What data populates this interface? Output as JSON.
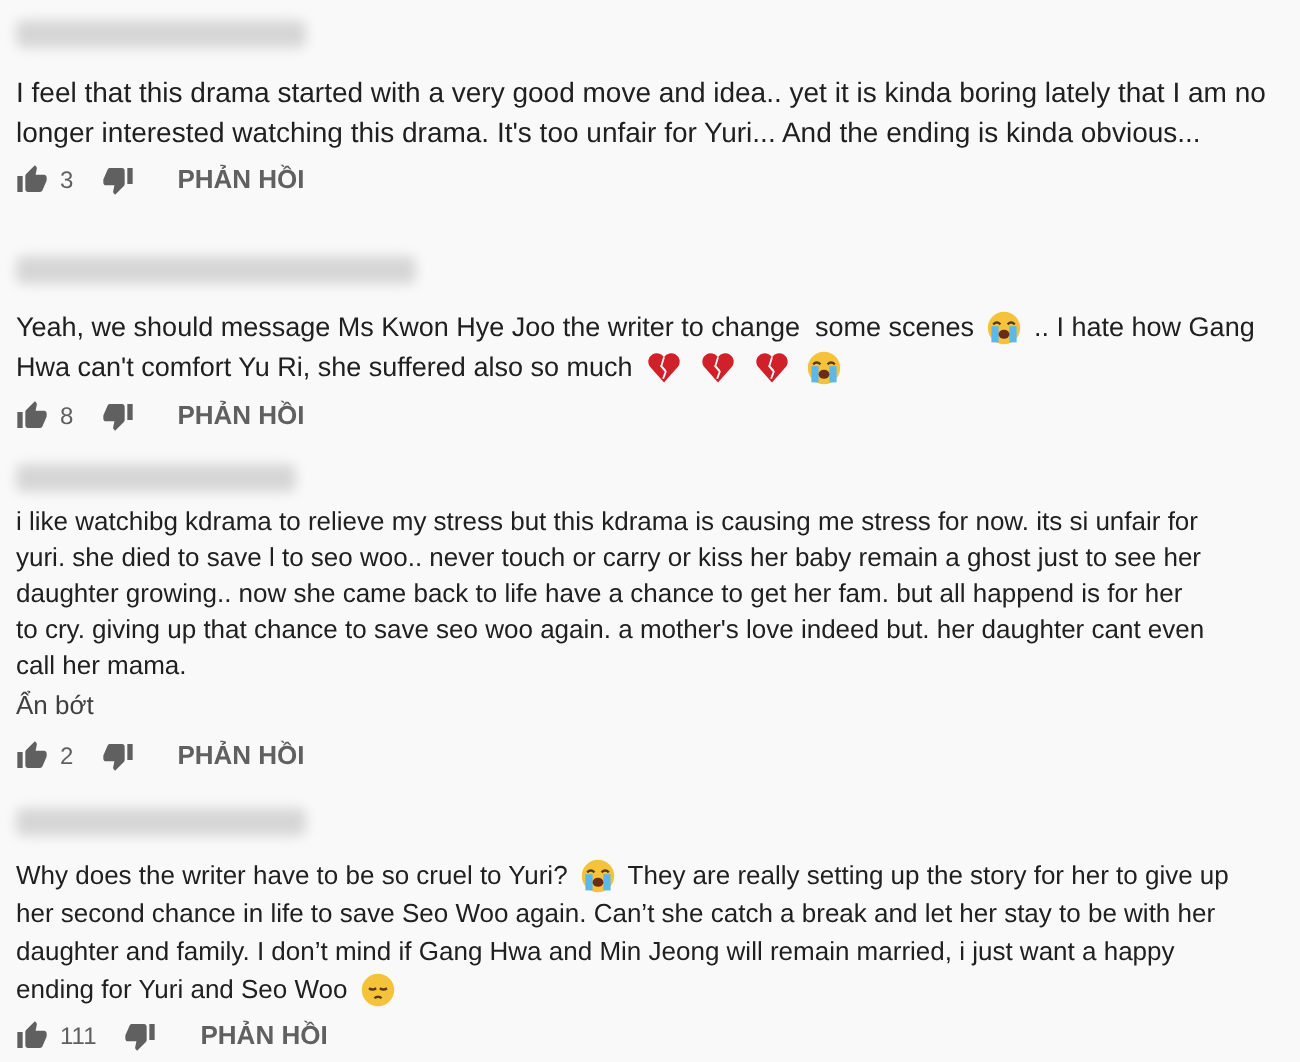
{
  "comments": [
    {
      "lines": [
        [
          {
            "kind": "text",
            "text": "I feel that this drama started with a very good move and idea.. yet it is kinda boring lately that I am no"
          }
        ],
        [
          {
            "kind": "text",
            "text": "longer interested watching this drama. It's too unfair for Yuri... And the ending is kinda obvious..."
          }
        ]
      ],
      "likes": "3",
      "reply": "PHẢN HỒI"
    },
    {
      "lines": [
        [
          {
            "kind": "text",
            "text": "Yeah, we should message Ms Kwon Hye Joo the writer to change  some scenes"
          },
          {
            "kind": "crying"
          },
          {
            "kind": "text",
            "text": ".. I hate how Gang"
          }
        ],
        [
          {
            "kind": "text",
            "text": "Hwa can't comfort Yu Ri, she suffered also so much"
          },
          {
            "kind": "broken_heart"
          },
          {
            "kind": "broken_heart"
          },
          {
            "kind": "broken_heart"
          },
          {
            "kind": "crying"
          }
        ]
      ],
      "likes": "8",
      "reply": "PHẢN HỒI"
    },
    {
      "lines": [
        [
          {
            "kind": "text",
            "text": "i like watchibg kdrama to relieve my stress but this kdrama is causing me stress for now. its si unfair for"
          }
        ],
        [
          {
            "kind": "text",
            "text": "yuri. she died to save l to seo woo.. never touch or carry or kiss her baby remain a ghost just to see her"
          }
        ],
        [
          {
            "kind": "text",
            "text": "daughter growing.. now she came back to life have a chance to get her fam. but all happend is for her"
          }
        ],
        [
          {
            "kind": "text",
            "text": "to cry. giving up that chance to save seo woo again. a mother's love indeed but. her daughter cant even"
          }
        ],
        [
          {
            "kind": "text",
            "text": "call her mama."
          }
        ]
      ],
      "collapse": "Ẩn bớt",
      "likes": "2",
      "reply": "PHẢN HỒI"
    },
    {
      "lines": [
        [
          {
            "kind": "text",
            "text": "Why does the writer have to be so cruel to Yuri?"
          },
          {
            "kind": "crying"
          },
          {
            "kind": "text",
            "text": "They are really setting up the story for her to give up"
          }
        ],
        [
          {
            "kind": "text",
            "text": "her second chance in life to save Seo Woo again. Can’t she catch a break and let her stay to be with her"
          }
        ],
        [
          {
            "kind": "text",
            "text": "daughter and family. I don’t mind if Gang Hwa and Min Jeong will remain married, i just want a happy"
          }
        ],
        [
          {
            "kind": "text",
            "text": "ending for Yuri and Seo Woo"
          },
          {
            "kind": "pensive"
          }
        ]
      ],
      "likes": "111",
      "reply": "PHẢN HỒI"
    }
  ]
}
